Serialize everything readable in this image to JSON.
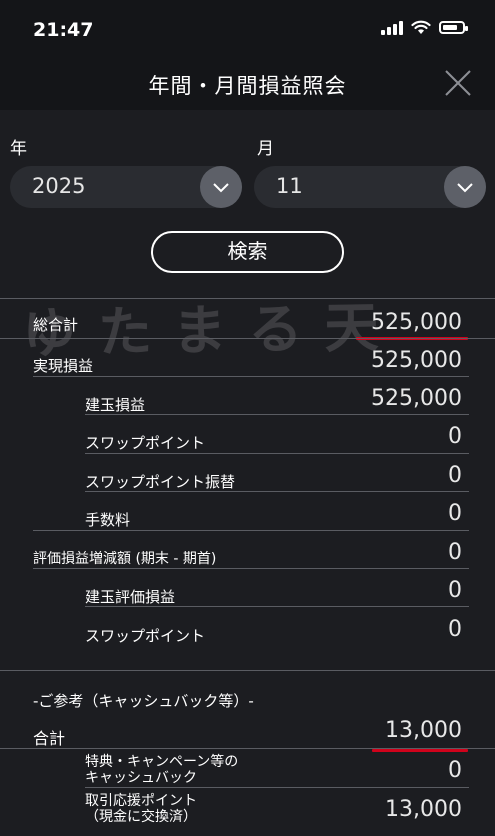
{
  "status": {
    "time": "21:47"
  },
  "nav": {
    "title": "年間・月間損益照会"
  },
  "filters": {
    "year_label": "年",
    "year_value": "2025",
    "month_label": "月",
    "month_value": "11",
    "search_label": "検索"
  },
  "watermark": "ゆたまる天",
  "summary": {
    "total_label": "総合計",
    "total_value": "525,000",
    "realized_label": "実現損益",
    "realized_value": "525,000",
    "position_pl_label": "建玉損益",
    "position_pl_value": "525,000",
    "swap_label": "スワップポイント",
    "swap_value": "0",
    "swap_transfer_label": "スワップポイント振替",
    "swap_transfer_value": "0",
    "fee_label": "手数料",
    "fee_value": "0",
    "valuation_label": "評価損益増減額 (期末 - 期首)",
    "valuation_value": "0",
    "position_val_label": "建玉評価損益",
    "position_val_value": "0",
    "swap2_label": "スワップポイント",
    "swap2_value": "0"
  },
  "reference": {
    "section_label": "-ご参考（キャッシュバック等）-",
    "total_label": "合計",
    "total_value": "13,000",
    "cashback_label_1": "特典・キャンペーン等の",
    "cashback_label_2": "キャッシュバック",
    "cashback_value": "0",
    "points_label_1": "取引応援ポイント",
    "points_label_2": "（現金に交換済）",
    "points_value": "13,000"
  },
  "colors": {
    "highlight_underline": "#d0021b",
    "background": "#1c1d21"
  }
}
